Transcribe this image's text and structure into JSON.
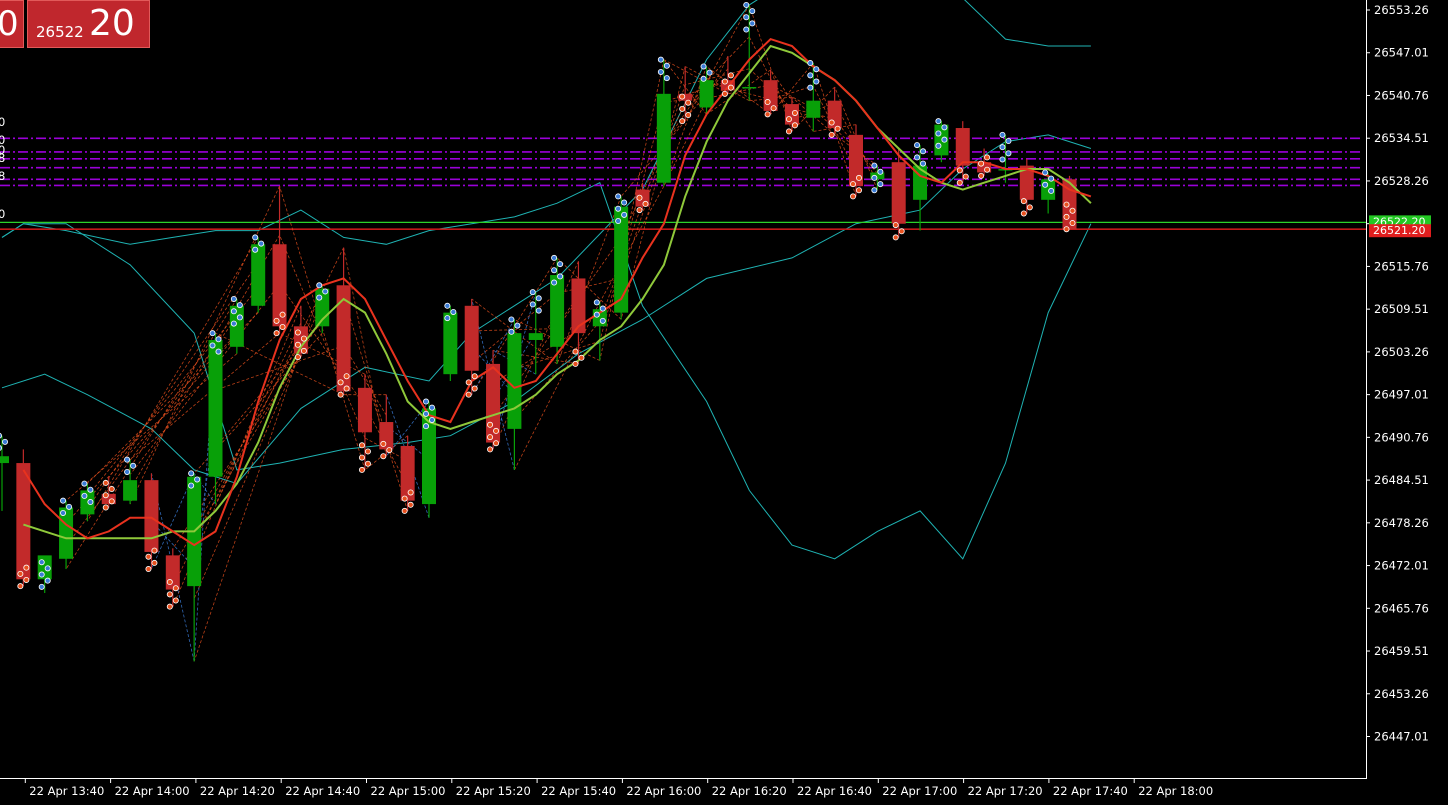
{
  "price_box": {
    "left_digit": "0",
    "small": "26522",
    "big": "20"
  },
  "current_price_labels": {
    "green": "26522.20",
    "red": "26521.20"
  },
  "left_edge_labels": [
    "0",
    "0",
    "0",
    "8",
    "8",
    "0"
  ],
  "colors": {
    "background": "#000000",
    "bull": "#08a008",
    "bear": "#c22a2a",
    "band": "#1fb3b3",
    "ma_fast": "#e8321e",
    "ma_slow": "#8fc83a",
    "level": "#9b00d9",
    "green_line": "#2bd02b",
    "red_line": "#c21a1a",
    "axis": "#ffffff"
  },
  "chart_data": {
    "type": "candlestick",
    "ylim": [
      26443.5,
      26554.7
    ],
    "y_ticks": [
      "26553.26",
      "26547.01",
      "26540.76",
      "26534.51",
      "26528.26",
      "26522.01",
      "26515.76",
      "26509.51",
      "26503.26",
      "26497.01",
      "26490.76",
      "26484.51",
      "26478.26",
      "26472.01",
      "26465.76",
      "26459.51",
      "26453.26",
      "26447.01"
    ],
    "x_ticks": [
      "22 Apr 13:40",
      "22 Apr 14:00",
      "22 Apr 14:20",
      "22 Apr 14:40",
      "22 Apr 15:00",
      "22 Apr 15:20",
      "22 Apr 15:40",
      "22 Apr 16:00",
      "22 Apr 16:20",
      "22 Apr 16:40",
      "22 Apr 17:00",
      "22 Apr 17:20",
      "22 Apr 17:40",
      "22 Apr 18:00"
    ],
    "candles": [
      {
        "o": 26487.0,
        "h": 26491.0,
        "l": 26480.0,
        "c": 26488.0
      },
      {
        "o": 26487.0,
        "h": 26489.0,
        "l": 26469.0,
        "c": 26470.0
      },
      {
        "o": 26470.0,
        "h": 26472.5,
        "l": 26468.0,
        "c": 26473.5
      },
      {
        "o": 26473.0,
        "h": 26481.5,
        "l": 26471.5,
        "c": 26480.5
      },
      {
        "o": 26479.5,
        "h": 26484.0,
        "l": 26478.5,
        "c": 26483.0
      },
      {
        "o": 26482.5,
        "h": 26485.0,
        "l": 26480.5,
        "c": 26481.0
      },
      {
        "o": 26481.5,
        "h": 26487.5,
        "l": 26481.0,
        "c": 26484.5
      },
      {
        "o": 26484.5,
        "h": 26485.5,
        "l": 26471.5,
        "c": 26474.0
      },
      {
        "o": 26473.5,
        "h": 26474.5,
        "l": 26466.0,
        "c": 26468.5
      },
      {
        "o": 26469.0,
        "h": 26485.5,
        "l": 26458.0,
        "c": 26485.0
      },
      {
        "o": 26485.0,
        "h": 26506.0,
        "l": 26481.0,
        "c": 26505.0
      },
      {
        "o": 26504.0,
        "h": 26511.0,
        "l": 26503.0,
        "c": 26510.0
      },
      {
        "o": 26510.0,
        "h": 26520.0,
        "l": 26509.0,
        "c": 26519.0
      },
      {
        "o": 26519.0,
        "h": 26527.5,
        "l": 26506.0,
        "c": 26507.0
      },
      {
        "o": 26507.0,
        "h": 26510.0,
        "l": 26502.5,
        "c": 26503.0
      },
      {
        "o": 26507.0,
        "h": 26513.0,
        "l": 26506.0,
        "c": 26512.5
      },
      {
        "o": 26513.0,
        "h": 26518.5,
        "l": 26497.0,
        "c": 26497.5
      },
      {
        "o": 26498.0,
        "h": 26500.0,
        "l": 26486.0,
        "c": 26491.5
      },
      {
        "o": 26493.0,
        "h": 26497.0,
        "l": 26488.0,
        "c": 26489.0
      },
      {
        "o": 26489.5,
        "h": 26491.0,
        "l": 26480.0,
        "c": 26481.5
      },
      {
        "o": 26481.0,
        "h": 26496.0,
        "l": 26479.0,
        "c": 26495.0
      },
      {
        "o": 26500.0,
        "h": 26510.0,
        "l": 26499.0,
        "c": 26509.0
      },
      {
        "o": 26510.0,
        "h": 26511.0,
        "l": 26497.0,
        "c": 26500.5
      },
      {
        "o": 26501.5,
        "h": 26503.5,
        "l": 26489.0,
        "c": 26490.0
      },
      {
        "o": 26492.0,
        "h": 26508.0,
        "l": 26486.0,
        "c": 26506.0
      },
      {
        "o": 26505.0,
        "h": 26512.0,
        "l": 26500.0,
        "c": 26506.0
      },
      {
        "o": 26504.0,
        "h": 26517.0,
        "l": 26501.5,
        "c": 26514.5
      },
      {
        "o": 26514.0,
        "h": 26516.5,
        "l": 26501.5,
        "c": 26506.0
      },
      {
        "o": 26507.0,
        "h": 26510.5,
        "l": 26502.0,
        "c": 26509.5
      },
      {
        "o": 26509.0,
        "h": 26526.0,
        "l": 26508.0,
        "c": 26524.5
      },
      {
        "o": 26527.0,
        "h": 26528.0,
        "l": 26524.0,
        "c": 26524.5
      },
      {
        "o": 26528.0,
        "h": 26546.0,
        "l": 26527.5,
        "c": 26541.0
      },
      {
        "o": 26541.0,
        "h": 26545.0,
        "l": 26537.0,
        "c": 26540.0
      },
      {
        "o": 26539.0,
        "h": 26545.0,
        "l": 26538.0,
        "c": 26543.0
      },
      {
        "o": 26543.0,
        "h": 26546.5,
        "l": 26541.0,
        "c": 26541.5
      },
      {
        "o": 26542.0,
        "h": 26554.0,
        "l": 26540.0,
        "c": 26542.0
      },
      {
        "o": 26543.0,
        "h": 26544.5,
        "l": 26538.0,
        "c": 26538.5
      },
      {
        "o": 26539.5,
        "h": 26540.5,
        "l": 26535.5,
        "c": 26536.5
      },
      {
        "o": 26537.5,
        "h": 26545.5,
        "l": 26535.5,
        "c": 26540.0
      },
      {
        "o": 26540.0,
        "h": 26542.0,
        "l": 26535.0,
        "c": 26536.0
      },
      {
        "o": 26535.0,
        "h": 26536.5,
        "l": 26526.0,
        "c": 26527.5
      },
      {
        "o": 26528.5,
        "h": 26530.5,
        "l": 26527.0,
        "c": 26529.5
      },
      {
        "o": 26531.0,
        "h": 26533.0,
        "l": 26520.0,
        "c": 26522.0
      },
      {
        "o": 26525.5,
        "h": 26533.5,
        "l": 26521.0,
        "c": 26530.5
      },
      {
        "o": 26532.0,
        "h": 26537.0,
        "l": 26531.0,
        "c": 26536.5
      },
      {
        "o": 26536.0,
        "h": 26537.0,
        "l": 26528.0,
        "c": 26530.5
      },
      {
        "o": 26531.0,
        "h": 26533.0,
        "l": 26529.0,
        "c": 26529.5
      },
      {
        "o": 26530.0,
        "h": 26535.0,
        "l": 26528.0,
        "c": 26530.0
      },
      {
        "o": 26530.5,
        "h": 26531.5,
        "l": 26523.5,
        "c": 26525.5
      },
      {
        "o": 26525.5,
        "h": 26529.5,
        "l": 26523.5,
        "c": 26528.5
      },
      {
        "o": 26528.5,
        "h": 26529.0,
        "l": 26521.2,
        "c": 26521.2
      }
    ],
    "ma_fast": [
      [
        1,
        26486
      ],
      [
        2,
        26481
      ],
      [
        3,
        26478
      ],
      [
        4,
        26476
      ],
      [
        5,
        26477
      ],
      [
        6,
        26479
      ],
      [
        7,
        26479
      ],
      [
        8,
        26477
      ],
      [
        9,
        26475
      ],
      [
        10,
        26477
      ],
      [
        11,
        26485
      ],
      [
        12,
        26496
      ],
      [
        13,
        26505
      ],
      [
        14,
        26511
      ],
      [
        15,
        26513
      ],
      [
        16,
        26514
      ],
      [
        17,
        26511
      ],
      [
        18,
        26505
      ],
      [
        19,
        26499
      ],
      [
        20,
        26494
      ],
      [
        21,
        26493
      ],
      [
        22,
        26499
      ],
      [
        23,
        26501
      ],
      [
        24,
        26498
      ],
      [
        25,
        26499
      ],
      [
        26,
        26503
      ],
      [
        27,
        26507
      ],
      [
        28,
        26509
      ],
      [
        29,
        26511
      ],
      [
        30,
        26517
      ],
      [
        31,
        26522
      ],
      [
        32,
        26532
      ],
      [
        33,
        26538
      ],
      [
        34,
        26542
      ],
      [
        35,
        26546
      ],
      [
        36,
        26549
      ],
      [
        37,
        26548
      ],
      [
        38,
        26545
      ],
      [
        39,
        26543
      ],
      [
        40,
        26540
      ],
      [
        41,
        26536
      ],
      [
        42,
        26532
      ],
      [
        43,
        26529
      ],
      [
        44,
        26528
      ],
      [
        45,
        26531
      ],
      [
        46,
        26531
      ],
      [
        47,
        26530
      ],
      [
        48,
        26530
      ],
      [
        49,
        26529
      ],
      [
        50,
        26527
      ],
      [
        51,
        26526
      ]
    ],
    "ma_slow": [
      [
        1,
        26478
      ],
      [
        2,
        26477
      ],
      [
        3,
        26476
      ],
      [
        4,
        26476
      ],
      [
        5,
        26476
      ],
      [
        6,
        26476
      ],
      [
        7,
        26476
      ],
      [
        8,
        26477
      ],
      [
        9,
        26477
      ],
      [
        10,
        26480
      ],
      [
        11,
        26484
      ],
      [
        12,
        26490
      ],
      [
        13,
        26498
      ],
      [
        14,
        26504
      ],
      [
        15,
        26508
      ],
      [
        16,
        26511
      ],
      [
        17,
        26509
      ],
      [
        18,
        26503
      ],
      [
        19,
        26496
      ],
      [
        20,
        26493
      ],
      [
        21,
        26492
      ],
      [
        22,
        26493
      ],
      [
        23,
        26494
      ],
      [
        24,
        26495
      ],
      [
        25,
        26497
      ],
      [
        26,
        26500
      ],
      [
        27,
        26502
      ],
      [
        28,
        26505
      ],
      [
        29,
        26507
      ],
      [
        30,
        26511
      ],
      [
        31,
        26516
      ],
      [
        32,
        26526
      ],
      [
        33,
        26534
      ],
      [
        34,
        26540
      ],
      [
        35,
        26544
      ],
      [
        36,
        26548
      ],
      [
        37,
        26547
      ],
      [
        38,
        26545
      ],
      [
        39,
        26543
      ],
      [
        40,
        26540
      ],
      [
        41,
        26536
      ],
      [
        42,
        26533
      ],
      [
        43,
        26530
      ],
      [
        44,
        26528
      ],
      [
        45,
        26527
      ],
      [
        46,
        26528
      ],
      [
        47,
        26529
      ],
      [
        48,
        26530
      ],
      [
        49,
        26530
      ],
      [
        50,
        26528
      ],
      [
        51,
        26525
      ]
    ],
    "band_upper": [
      [
        0,
        26498
      ],
      [
        2,
        26500
      ],
      [
        4,
        26497
      ],
      [
        7,
        26492
      ],
      [
        9,
        26486
      ],
      [
        11,
        26484
      ],
      [
        14,
        26495
      ],
      [
        17,
        26501
      ],
      [
        20,
        26499
      ],
      [
        22,
        26506
      ],
      [
        26,
        26514
      ],
      [
        30,
        26527
      ],
      [
        33,
        26546
      ],
      [
        35,
        26554
      ],
      [
        37,
        26558
      ],
      [
        40,
        26560
      ],
      [
        43,
        26557
      ],
      [
        45,
        26555
      ],
      [
        47,
        26549
      ],
      [
        49,
        26548
      ],
      [
        51,
        26548
      ]
    ],
    "band_middle": [
      [
        0,
        26520
      ],
      [
        1,
        26522
      ],
      [
        3,
        26522
      ],
      [
        6,
        26516
      ],
      [
        9,
        26506
      ],
      [
        11,
        26486
      ],
      [
        13,
        26487
      ],
      [
        16,
        26489
      ],
      [
        19,
        26490
      ],
      [
        21,
        26491
      ],
      [
        24,
        26496
      ],
      [
        27,
        26503
      ],
      [
        30,
        26508
      ],
      [
        33,
        26514
      ],
      [
        37,
        26517
      ],
      [
        40,
        26522
      ],
      [
        43,
        26524
      ],
      [
        45,
        26530
      ],
      [
        47,
        26534
      ],
      [
        49,
        26535
      ],
      [
        51,
        26533
      ]
    ],
    "band_lower": [
      [
        0,
        26520
      ],
      [
        1,
        26522
      ],
      [
        3,
        26521
      ],
      [
        6,
        26519
      ],
      [
        8,
        26520
      ],
      [
        10,
        26521
      ],
      [
        12,
        26521
      ],
      [
        14,
        26524
      ],
      [
        16,
        26520
      ],
      [
        18,
        26519
      ],
      [
        20,
        26521
      ],
      [
        22,
        26522
      ],
      [
        24,
        26523
      ],
      [
        26,
        26525
      ],
      [
        28,
        26528
      ],
      [
        30,
        26510
      ],
      [
        33,
        26496
      ],
      [
        35,
        26483
      ],
      [
        37,
        26475
      ],
      [
        39,
        26473
      ],
      [
        41,
        26477
      ],
      [
        43,
        26480
      ],
      [
        45,
        26473
      ],
      [
        47,
        26487
      ],
      [
        49,
        26509
      ],
      [
        51,
        26522
      ]
    ],
    "levels": [
      26534.5,
      26532.5,
      26531.5,
      26530.2,
      26528.5,
      26527.6
    ],
    "green_level": 26522.2,
    "red_level": 26521.2
  }
}
